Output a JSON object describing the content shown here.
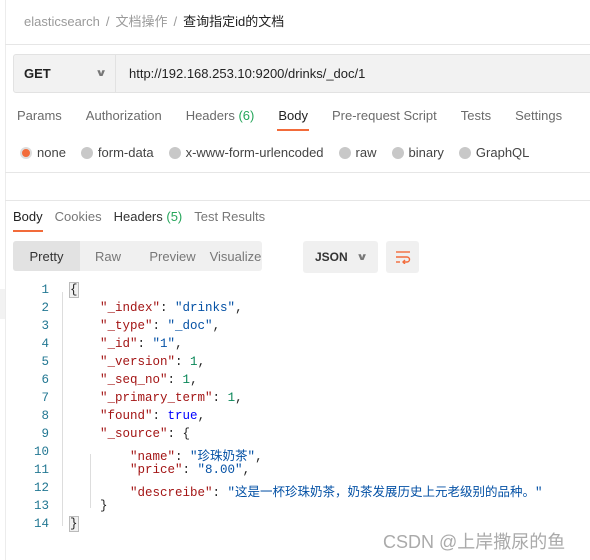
{
  "breadcrumb": {
    "items": [
      "elasticsearch",
      "文档操作"
    ],
    "current": "查询指定id的文档",
    "sep": "/"
  },
  "request": {
    "method": "GET",
    "url": "http://192.168.253.10:9200/drinks/_doc/1"
  },
  "req_tabs": [
    {
      "label": "Params"
    },
    {
      "label": "Authorization"
    },
    {
      "label": "Headers",
      "count": "(6)"
    },
    {
      "label": "Body",
      "active": true
    },
    {
      "label": "Pre-request Script"
    },
    {
      "label": "Tests"
    },
    {
      "label": "Settings"
    }
  ],
  "body_types": [
    {
      "label": "none",
      "selected": true
    },
    {
      "label": "form-data"
    },
    {
      "label": "x-www-form-urlencoded"
    },
    {
      "label": "raw"
    },
    {
      "label": "binary"
    },
    {
      "label": "GraphQL"
    }
  ],
  "res_tabs": [
    {
      "label": "Body",
      "active": true
    },
    {
      "label": "Cookies"
    },
    {
      "label": "Headers",
      "count": "(5)"
    },
    {
      "label": "Test Results"
    }
  ],
  "view_modes": [
    "Pretty",
    "Raw",
    "Preview",
    "Visualize"
  ],
  "format": "JSON",
  "icons": {
    "method_dropdown": "chevron-down-icon",
    "format_dropdown": "chevron-down-icon",
    "wrap": "wrap-lines-icon"
  },
  "colors": {
    "accent": "#f26b3a",
    "key": "#a31515",
    "string": "#0451a5",
    "number": "#098658",
    "bool": "#0000ff"
  },
  "code_lines": [
    [
      [
        "p",
        "{"
      ]
    ],
    [
      [
        "p",
        "    "
      ],
      [
        "k",
        "\"_index\""
      ],
      [
        "p",
        ": "
      ],
      [
        "s",
        "\"drinks\""
      ],
      [
        "p",
        ","
      ]
    ],
    [
      [
        "p",
        "    "
      ],
      [
        "k",
        "\"_type\""
      ],
      [
        "p",
        ": "
      ],
      [
        "s",
        "\"_doc\""
      ],
      [
        "p",
        ","
      ]
    ],
    [
      [
        "p",
        "    "
      ],
      [
        "k",
        "\"_id\""
      ],
      [
        "p",
        ": "
      ],
      [
        "s",
        "\"1\""
      ],
      [
        "p",
        ","
      ]
    ],
    [
      [
        "p",
        "    "
      ],
      [
        "k",
        "\"_version\""
      ],
      [
        "p",
        ": "
      ],
      [
        "n",
        "1"
      ],
      [
        "p",
        ","
      ]
    ],
    [
      [
        "p",
        "    "
      ],
      [
        "k",
        "\"_seq_no\""
      ],
      [
        "p",
        ": "
      ],
      [
        "n",
        "1"
      ],
      [
        "p",
        ","
      ]
    ],
    [
      [
        "p",
        "    "
      ],
      [
        "k",
        "\"_primary_term\""
      ],
      [
        "p",
        ": "
      ],
      [
        "n",
        "1"
      ],
      [
        "p",
        ","
      ]
    ],
    [
      [
        "p",
        "    "
      ],
      [
        "k",
        "\"found\""
      ],
      [
        "p",
        ": "
      ],
      [
        "b",
        "true"
      ],
      [
        "p",
        ","
      ]
    ],
    [
      [
        "p",
        "    "
      ],
      [
        "k",
        "\"_source\""
      ],
      [
        "p",
        ": {"
      ]
    ],
    [
      [
        "p",
        "        "
      ],
      [
        "k",
        "\"name\""
      ],
      [
        "p",
        ": "
      ],
      [
        "s",
        "\"珍珠奶茶\""
      ],
      [
        "p",
        ","
      ]
    ],
    [
      [
        "p",
        "        "
      ],
      [
        "k",
        "\"price\""
      ],
      [
        "p",
        ": "
      ],
      [
        "s",
        "\"8.00\""
      ],
      [
        "p",
        ","
      ]
    ],
    [
      [
        "p",
        "        "
      ],
      [
        "k",
        "\"descreibe\""
      ],
      [
        "p",
        ": "
      ],
      [
        "s",
        "\"这是一杯珍珠奶茶，奶茶发展历史上元老级别的品种。\""
      ]
    ],
    [
      [
        "p",
        "    }"
      ]
    ],
    [
      [
        "p",
        "}"
      ]
    ]
  ],
  "watermark": "CSDN @上岸撒尿的鱼"
}
